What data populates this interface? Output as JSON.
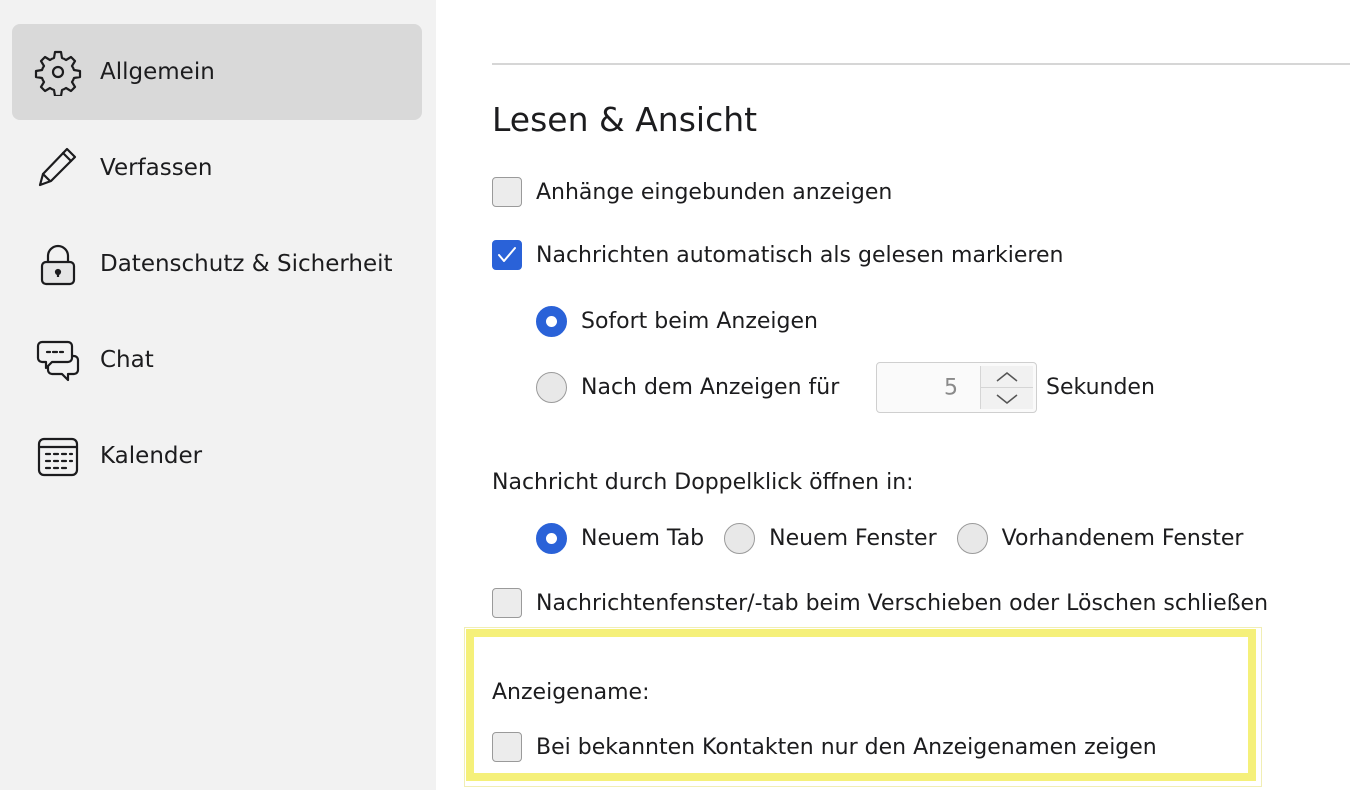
{
  "sidebar": {
    "items": [
      {
        "label": "Allgemein",
        "icon": "gear-icon",
        "selected": true
      },
      {
        "label": "Verfassen",
        "icon": "pencil-icon",
        "selected": false
      },
      {
        "label": "Datenschutz & Sicherheit",
        "icon": "lock-icon",
        "selected": false
      },
      {
        "label": "Chat",
        "icon": "chat-bubbles-icon",
        "selected": false
      },
      {
        "label": "Kalender",
        "icon": "calendar-icon",
        "selected": false
      }
    ]
  },
  "main": {
    "section_title": "Lesen & Ansicht",
    "show_attachments_inline": {
      "label": "Anhänge eingebunden anzeigen",
      "checked": false
    },
    "auto_mark_read": {
      "label": "Nachrichten automatisch als gelesen markieren",
      "checked": true
    },
    "mark_immediately": {
      "label": "Sofort beim Anzeigen",
      "selected": true
    },
    "mark_after": {
      "label": "Nach dem Anzeigen für",
      "selected": false,
      "seconds_value": "5",
      "unit_label": "Sekunden"
    },
    "open_double_click": {
      "label": "Nachricht durch Doppelklick öffnen in:",
      "options": [
        {
          "label": "Neuem Tab",
          "selected": true
        },
        {
          "label": "Neuem Fenster",
          "selected": false
        },
        {
          "label": "Vorhandenem Fenster",
          "selected": false
        }
      ]
    },
    "close_on_move_delete": {
      "label": "Nachrichtenfenster/-tab beim Verschieben oder Löschen schließen",
      "checked": false
    },
    "display_name": {
      "heading": "Anzeigename:",
      "only_display_name": {
        "label": "Bei bekannten Kontakten nur den Anzeigenamen zeigen",
        "checked": false
      }
    }
  },
  "colors": {
    "accent": "#2a62d8",
    "sidebar_bg": "#f2f2f2",
    "sidebar_selected": "#d9d9d9",
    "highlight": "#f5f07a"
  }
}
